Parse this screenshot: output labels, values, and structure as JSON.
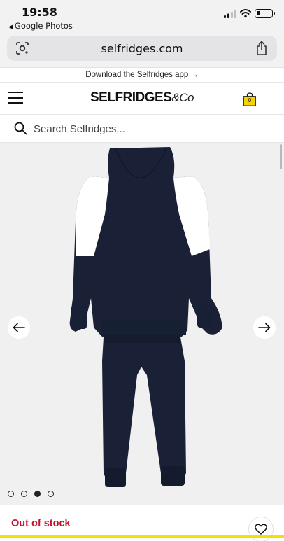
{
  "status_bar": {
    "time": "19:58",
    "back_app": "Google Photos"
  },
  "browser": {
    "url": "selfridges.com"
  },
  "promo": {
    "text": "Download the Selfridges app"
  },
  "header": {
    "logo_main": "SELFRIDGES",
    "logo_suffix": "&Co",
    "bag_count": "0"
  },
  "search": {
    "placeholder": "Search Selfridges..."
  },
  "gallery": {
    "total_images": 4,
    "active_index": 2,
    "product_colors": {
      "navy": "#1a2137",
      "white": "#ffffff"
    }
  },
  "product": {
    "stock_status": "Out of stock",
    "stock_color": "#c8102e"
  },
  "icons": [
    "lens-icon",
    "share-icon",
    "menu-icon",
    "bag-icon",
    "search-icon",
    "arrow-left-icon",
    "arrow-right-icon",
    "heart-icon"
  ]
}
